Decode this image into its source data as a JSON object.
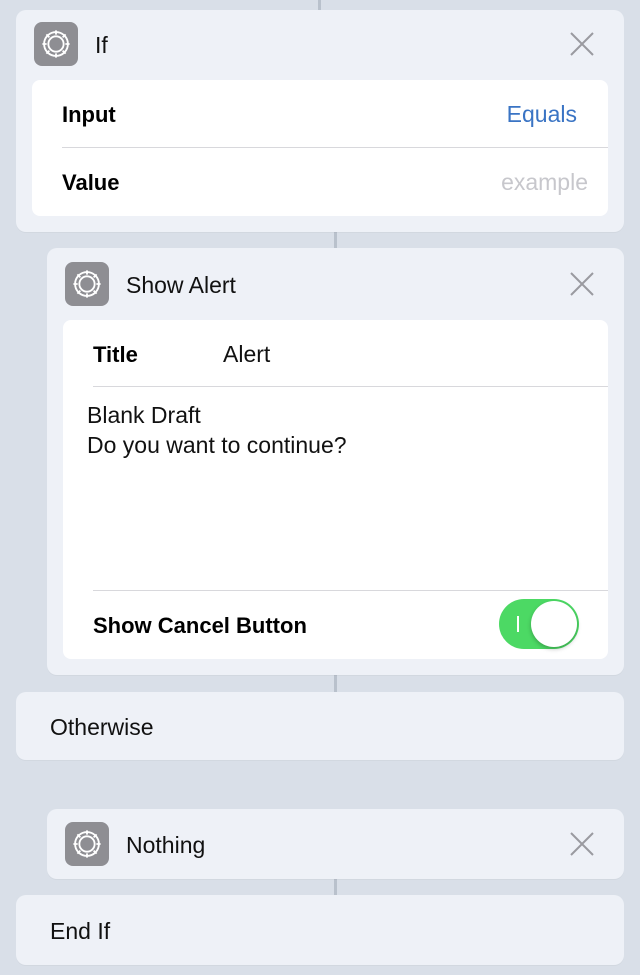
{
  "if_block": {
    "title": "If",
    "icon": "gear-icon",
    "input_label": "Input",
    "input_value": "Equals",
    "value_label": "Value",
    "value_placeholder": "example"
  },
  "alert_block": {
    "title": "Show Alert",
    "icon": "gear-icon",
    "title_label": "Title",
    "title_value": "Alert",
    "message_line1": "Blank Draft",
    "message_line2": "Do you want to continue?",
    "cancel_label": "Show Cancel Button",
    "cancel_on": true
  },
  "otherwise": {
    "label": "Otherwise"
  },
  "nothing_block": {
    "title": "Nothing",
    "icon": "gear-icon"
  },
  "end_if": {
    "label": "End If"
  },
  "colors": {
    "accent_blue": "#3a74c4",
    "toggle_green": "#4cd964",
    "placeholder": "#c7c7cc",
    "background": "#d9dfe8",
    "card": "#eef1f7"
  }
}
